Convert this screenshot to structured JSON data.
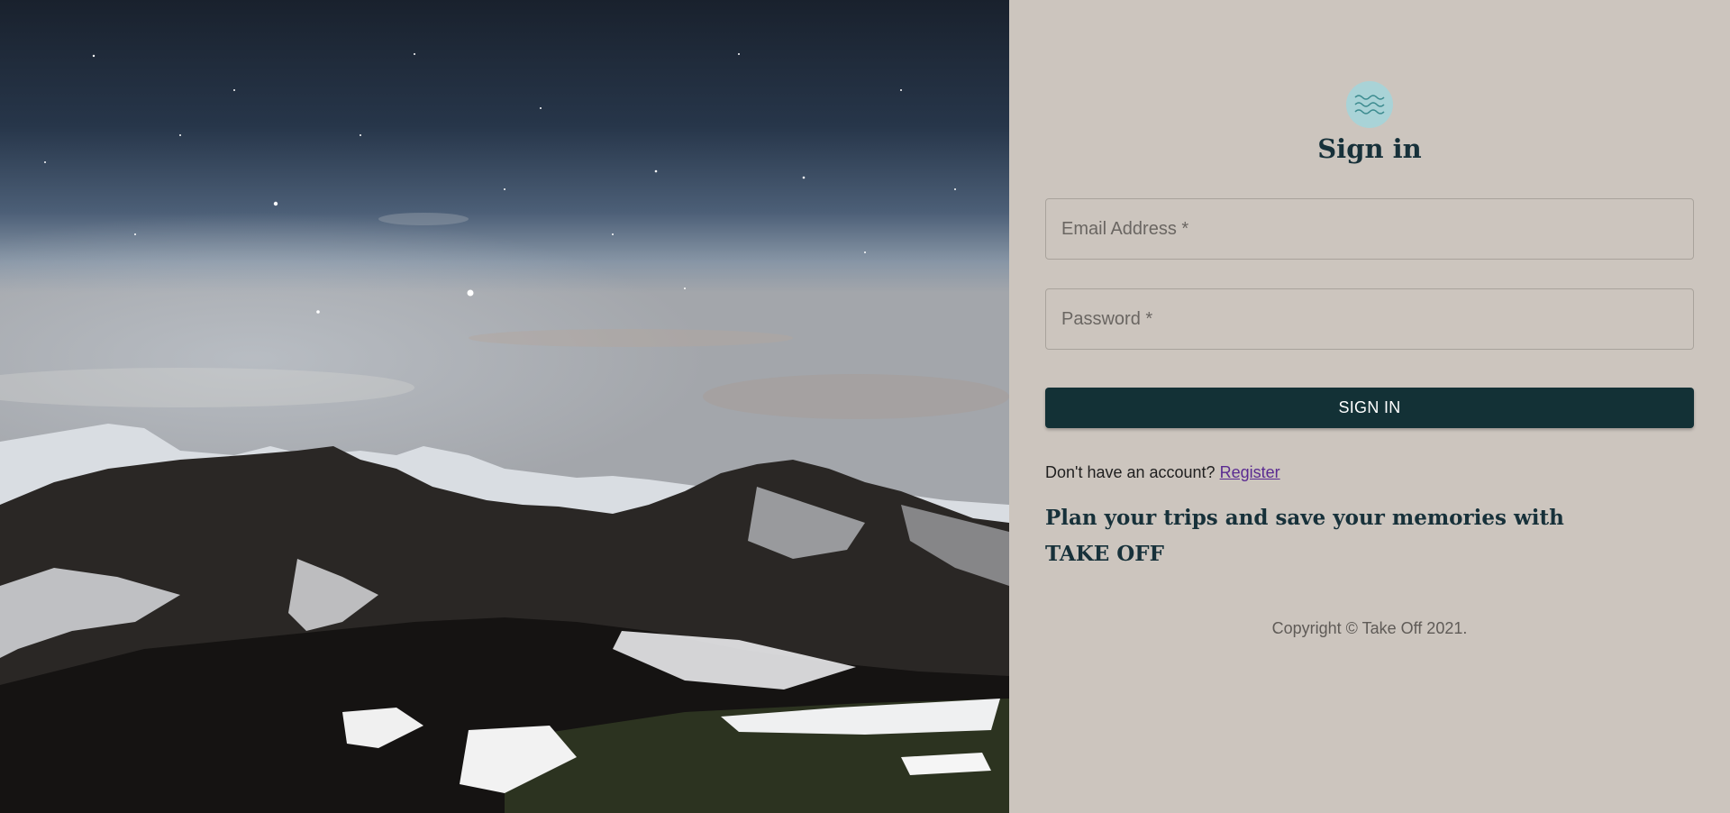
{
  "hero": {
    "image": "night-sky-mountains"
  },
  "auth": {
    "logo_icon": "waves-icon",
    "title": "Sign in",
    "email_placeholder": "Email Address *",
    "password_placeholder": "Password *",
    "submit_label": "SIGN IN",
    "register_prompt": "Don't have an account?",
    "register_link": "Register",
    "tagline_line1": "Plan your trips and save your memories with",
    "tagline_line2": "TAKE OFF",
    "copyright": "Copyright © Take Off 2021."
  },
  "colors": {
    "panel_bg": "#ccc5be",
    "primary": "#133136",
    "title": "#17313a",
    "link": "#5a2a91",
    "logo_bg": "#a9d3d7"
  }
}
